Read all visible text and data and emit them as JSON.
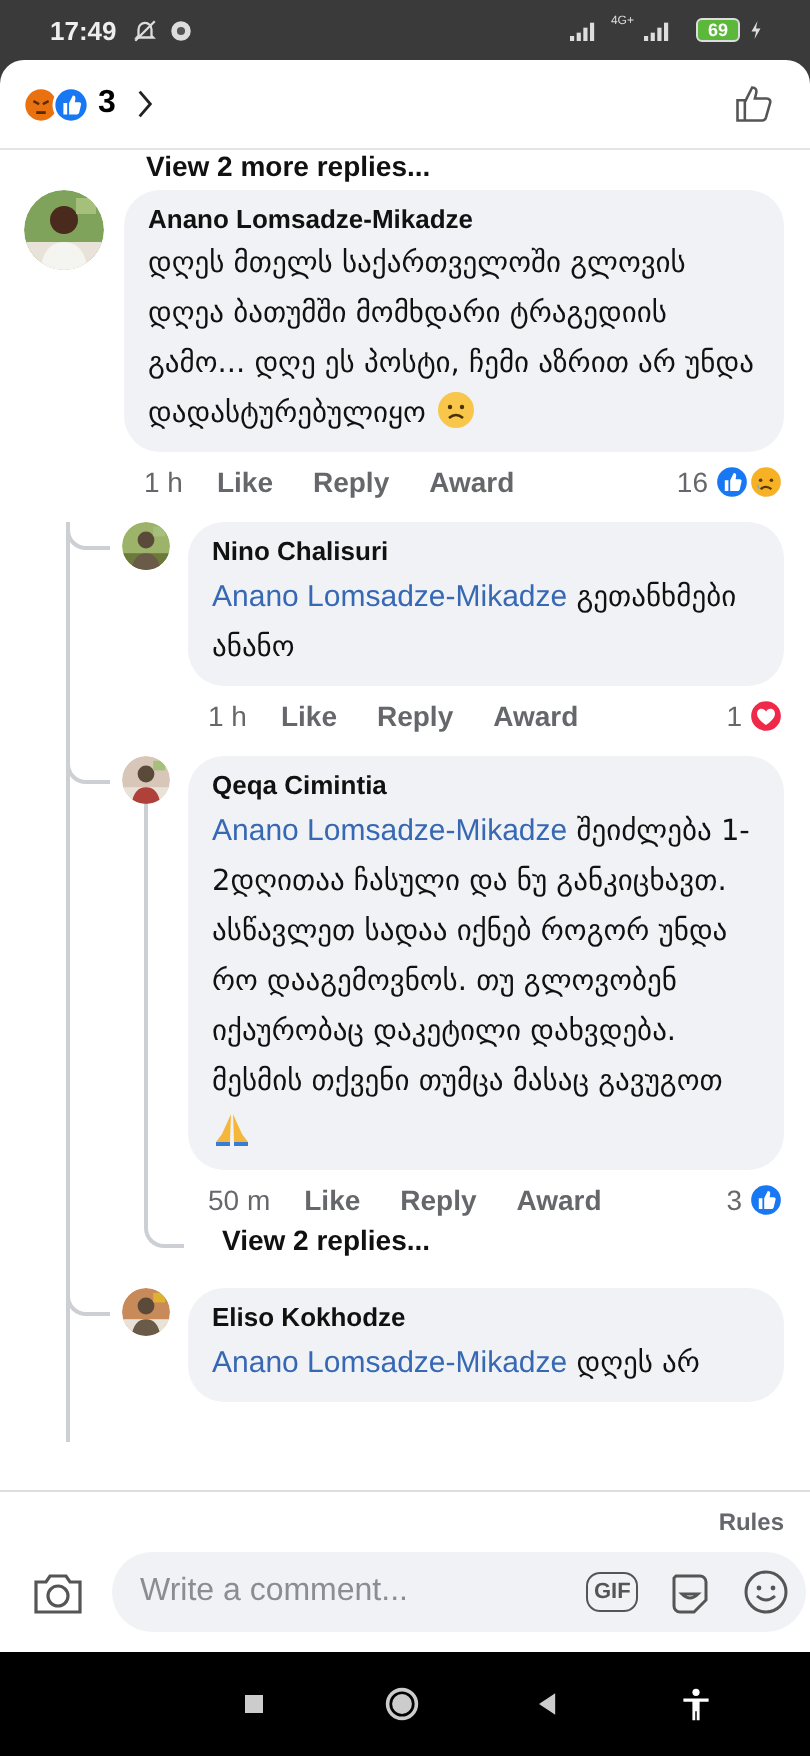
{
  "status_bar": {
    "time": "17:49",
    "network": "4G+",
    "battery": "69"
  },
  "header": {
    "reactions": [
      {
        "kind": "angry"
      },
      {
        "kind": "like"
      }
    ],
    "count": "3"
  },
  "view_more_top": "View 2 more replies...",
  "comment": {
    "name": "Anano Lomsadze-Mikadze",
    "text": "დღეს მთელს საქართველოში გლოვის დღეა ბათუმში მომხდარი ტრაგედიის გამო... დღე ეს პოსტი, ჩემი აზრით არ უნდა დადასტურებულიყო",
    "trailing_icon": {
      "kind": "sad"
    },
    "time": "1 h",
    "actions": [
      "Like",
      "Reply",
      "Award"
    ],
    "count": "16",
    "reactions": [
      {
        "kind": "like"
      },
      {
        "kind": "sad"
      }
    ],
    "replies": [
      {
        "name": "Nino Chalisuri",
        "mention": "Anano Lomsadze-Mikadze",
        "text": "გეთანხმები ანანო",
        "time": "1 h",
        "actions": [
          "Like",
          "Reply",
          "Award"
        ],
        "count": "1",
        "reactions": [
          {
            "kind": "love"
          }
        ]
      },
      {
        "name": "Qeqa Cimintia",
        "mention": "Anano Lomsadze-Mikadze",
        "text": "შეიძლება 1-2დღითაა ჩასული და ნუ განკიცხავთ.  ასწავლეთ სადაა იქნებ როგორ უნდა რო დააგემოვნოს. თუ გლოვობენ იქაურობაც დაკეტილი დახვდება. მესმის თქვენი თუმცა მასაც გავუგოთ",
        "trailing_icon": {
          "kind": "pray"
        },
        "time": "50 m",
        "actions": [
          "Like",
          "Reply",
          "Award"
        ],
        "count": "3",
        "reactions": [
          {
            "kind": "like"
          }
        ],
        "view_replies": "View 2 replies..."
      },
      {
        "name": "Eliso Kokhodze",
        "mention": "Anano Lomsadze-Mikadze",
        "text": "დღეს არ"
      }
    ]
  },
  "composer": {
    "rules": "Rules",
    "placeholder": "Write a comment...",
    "gif": "GIF"
  }
}
